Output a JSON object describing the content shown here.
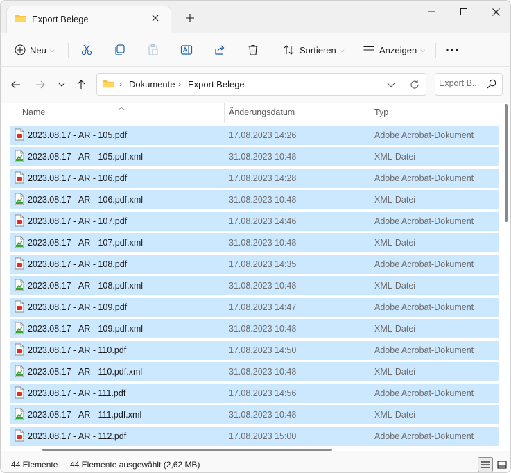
{
  "tab": {
    "title": "Export Belege",
    "icon": "folder-icon"
  },
  "window_buttons": {
    "minimize": "minimize-icon",
    "maximize": "maximize-icon",
    "close": "close-icon"
  },
  "commandbar": {
    "new_label": "Neu",
    "sort_label": "Sortieren",
    "view_label": "Anzeigen",
    "icons": [
      "cut-icon",
      "copy-icon",
      "paste-icon",
      "rename-icon",
      "share-icon",
      "delete-icon",
      "more-icon"
    ]
  },
  "breadcrumb": [
    "Dokumente",
    "Export Belege"
  ],
  "search": {
    "placeholder": "Export B..."
  },
  "columns": {
    "name": "Name",
    "date": "Änderungsdatum",
    "type": "Typ"
  },
  "files": [
    {
      "name": "2023.08.17 - AR - 105.pdf",
      "date": "17.08.2023 14:26",
      "type": "Adobe Acrobat-Dokument",
      "icon": "pdf-icon"
    },
    {
      "name": "2023.08.17 - AR - 105.pdf.xml",
      "date": "31.08.2023 10:48",
      "type": "XML-Datei",
      "icon": "xml-icon"
    },
    {
      "name": "2023.08.17 - AR - 106.pdf",
      "date": "17.08.2023 14:28",
      "type": "Adobe Acrobat-Dokument",
      "icon": "pdf-icon"
    },
    {
      "name": "2023.08.17 - AR - 106.pdf.xml",
      "date": "31.08.2023 10:48",
      "type": "XML-Datei",
      "icon": "xml-icon"
    },
    {
      "name": "2023.08.17 - AR - 107.pdf",
      "date": "17.08.2023 14:46",
      "type": "Adobe Acrobat-Dokument",
      "icon": "pdf-icon"
    },
    {
      "name": "2023.08.17 - AR - 107.pdf.xml",
      "date": "31.08.2023 10:48",
      "type": "XML-Datei",
      "icon": "xml-icon"
    },
    {
      "name": "2023.08.17 - AR - 108.pdf",
      "date": "17.08.2023 14:35",
      "type": "Adobe Acrobat-Dokument",
      "icon": "pdf-icon"
    },
    {
      "name": "2023.08.17 - AR - 108.pdf.xml",
      "date": "31.08.2023 10:48",
      "type": "XML-Datei",
      "icon": "xml-icon"
    },
    {
      "name": "2023.08.17 - AR - 109.pdf",
      "date": "17.08.2023 14:47",
      "type": "Adobe Acrobat-Dokument",
      "icon": "pdf-icon"
    },
    {
      "name": "2023.08.17 - AR - 109.pdf.xml",
      "date": "31.08.2023 10:48",
      "type": "XML-Datei",
      "icon": "xml-icon"
    },
    {
      "name": "2023.08.17 - AR - 110.pdf",
      "date": "17.08.2023 14:50",
      "type": "Adobe Acrobat-Dokument",
      "icon": "pdf-icon"
    },
    {
      "name": "2023.08.17 - AR - 110.pdf.xml",
      "date": "31.08.2023 10:48",
      "type": "XML-Datei",
      "icon": "xml-icon"
    },
    {
      "name": "2023.08.17 - AR - 111.pdf",
      "date": "17.08.2023 14:56",
      "type": "Adobe Acrobat-Dokument",
      "icon": "pdf-icon"
    },
    {
      "name": "2023.08.17 - AR - 111.pdf.xml",
      "date": "31.08.2023 10:48",
      "type": "XML-Datei",
      "icon": "xml-icon"
    },
    {
      "name": "2023.08.17 - AR - 112.pdf",
      "date": "17.08.2023 15:00",
      "type": "Adobe Acrobat-Dokument",
      "icon": "pdf-icon"
    }
  ],
  "status": {
    "count": "44 Elemente",
    "selected": "44 Elemente ausgewählt (2,62 MB)"
  },
  "colors": {
    "selection": "#cce8ff",
    "folder": "#f4c343",
    "pdf": "#d93025",
    "xml": "#3aa335"
  }
}
